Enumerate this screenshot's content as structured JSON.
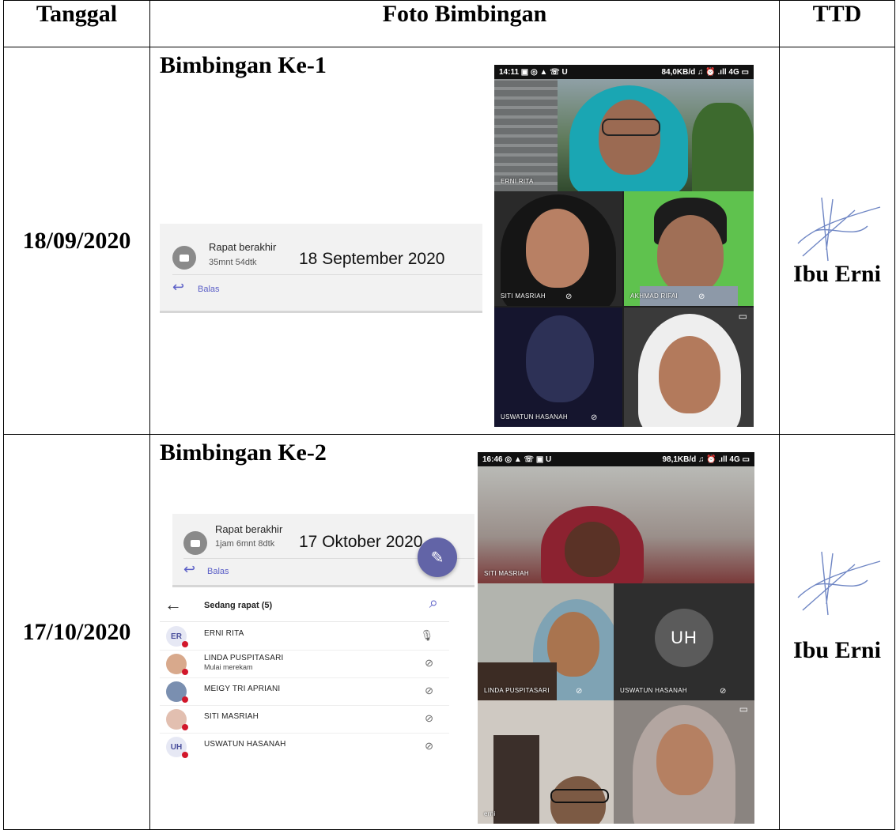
{
  "table": {
    "headers": [
      "Tanggal",
      "Foto Bimbingan",
      "TTD"
    ]
  },
  "rows": [
    {
      "date": "18/09/2020",
      "session_title": "Bimbingan Ke-1",
      "card": {
        "status": "Rapat berakhir",
        "duration": "35mnt 54dtk",
        "date": "18 September 2020",
        "reply": "Balas"
      },
      "phone": {
        "status_left": "14:11 ▣ ◎ ▲ ☏ U",
        "status_right": "84,0KB/d ♫ ⏰ .ıll 4G ▭",
        "tiles": [
          "ERNI RITA",
          "SITI MASRIAH",
          "AKHMAD RIFAI",
          "USWATUN HASANAH"
        ]
      },
      "signer": "Ibu Erni"
    },
    {
      "date": "17/10/2020",
      "session_title": "Bimbingan Ke-2",
      "card": {
        "status": "Rapat berakhir",
        "duration": "1jam 6mnt 8dtk",
        "date": "17 Oktober 2020",
        "reply": "Balas"
      },
      "participants": {
        "title": "Sedang rapat (5)",
        "list": [
          {
            "initials": "ER",
            "name": "ERNI RITA",
            "sub": ""
          },
          {
            "initials": "",
            "name": "LINDA PUSPITASARI",
            "sub": "Mulai merekam"
          },
          {
            "initials": "",
            "name": "MEIGY TRI APRIANI",
            "sub": ""
          },
          {
            "initials": "",
            "name": "SITI MASRIAH",
            "sub": ""
          },
          {
            "initials": "UH",
            "name": "USWATUN HASANAH",
            "sub": ""
          }
        ]
      },
      "phone": {
        "status_left": "16:46 ◎ ▲ ☏ ▣ U",
        "status_right": "98,1KB/d ♫ ⏰ .ıll 4G ▭",
        "tiles": [
          "SITI MASRIAH",
          "LINDA PUSPITASARI",
          "USWATUN HASANAH",
          "erni"
        ],
        "avatar_initials": "UH"
      },
      "signer": "Ibu Erni"
    }
  ],
  "icon_names": [
    "video-camera-icon",
    "reply-arrow-icon",
    "back-arrow-icon",
    "search-icon",
    "mic-icon",
    "mic-off-icon",
    "edit-icon",
    "signature-icon"
  ]
}
